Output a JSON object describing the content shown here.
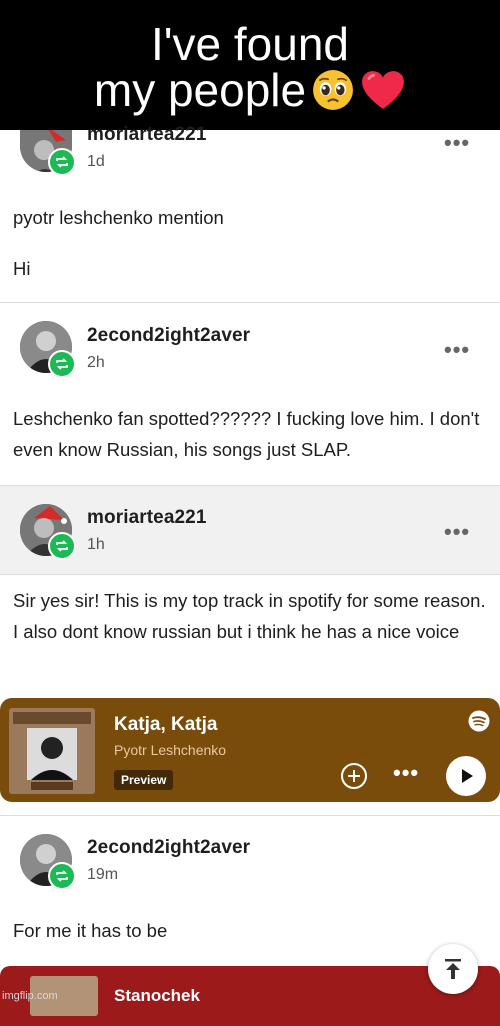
{
  "meme_caption": {
    "line1": "I've found",
    "line2": "my people"
  },
  "posts": [
    {
      "username": "moriartea221",
      "time": "1d",
      "lines": [
        "pyotr leshchenko mention",
        "Hi"
      ]
    },
    {
      "username": "2econd2ight2aver",
      "time": "2h",
      "text": "Leshchenko fan spotted?????? I fucking love him. I don't even know Russian, his songs just SLAP."
    },
    {
      "username": "moriartea221",
      "time": "1h",
      "text": "Sir yes sir! This is my top track in spotify for some reason. I also dont know russian but i think he has a nice voice"
    },
    {
      "username": "2econd2ight2aver",
      "time": "19m",
      "text": "For me it has to be"
    }
  ],
  "spotify_embed": {
    "track": "Katja, Katja",
    "artist": "Pyotr Leshchenko",
    "badge": "Preview",
    "color": "#7a4c0c"
  },
  "bottom_embed": {
    "track": "Stanochek",
    "color": "#9c1a1a"
  },
  "watermark": "imgflip.com",
  "icons": [
    "reblog-icon",
    "more-options-icon",
    "add-icon",
    "play-icon",
    "spotify-logo-icon",
    "scroll-to-top-icon"
  ]
}
